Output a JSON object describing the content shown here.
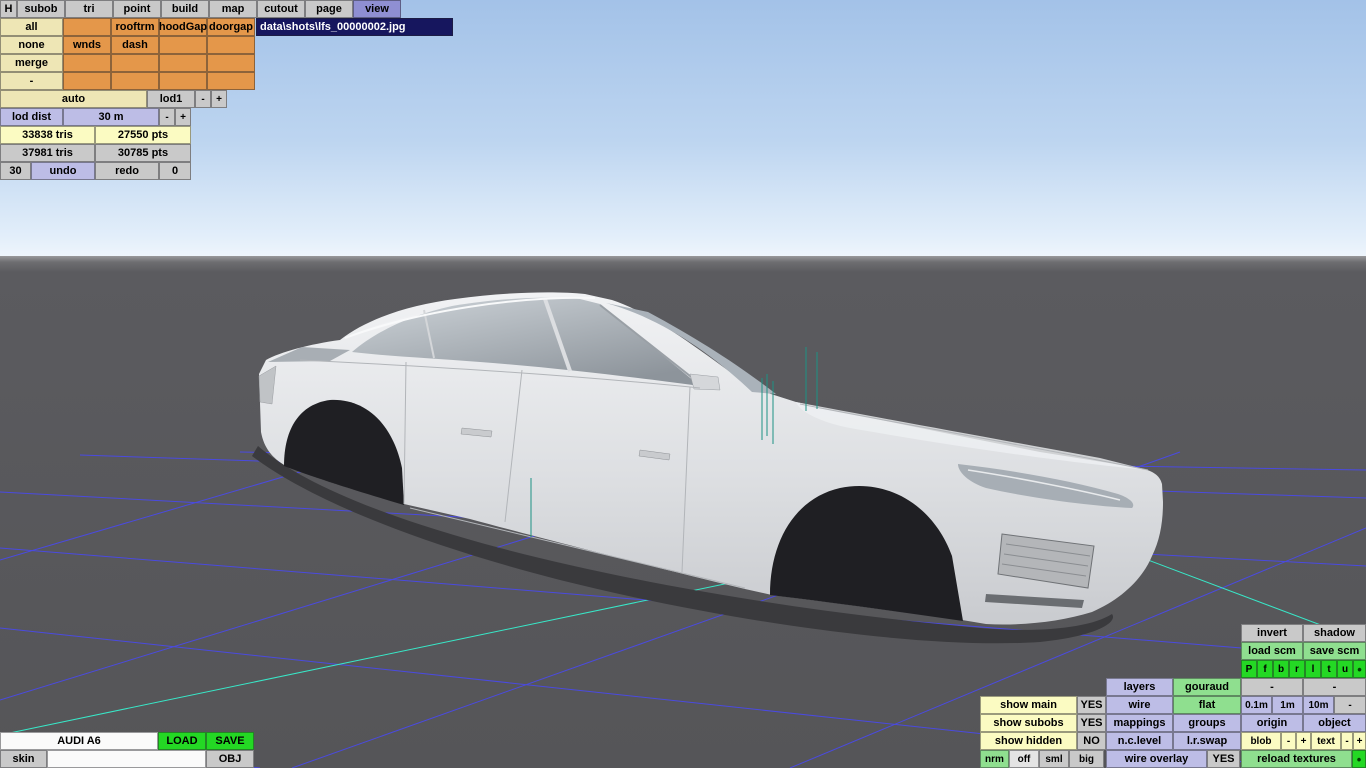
{
  "menubar": {
    "items": [
      "H",
      "subob",
      "tri",
      "point",
      "build",
      "map",
      "cutout",
      "page",
      "view"
    ],
    "active": "view"
  },
  "filebar": {
    "path": "data\\shots\\lfs_00000002.jpg"
  },
  "subob_grid": {
    "rows": [
      {
        "label": "all",
        "cells": [
          "",
          "rooftrm",
          "hoodGap",
          "doorgap"
        ]
      },
      {
        "label": "none",
        "cells": [
          "wnds",
          "dash",
          "",
          ""
        ]
      },
      {
        "label": "merge",
        "cells": [
          "",
          "",
          "",
          ""
        ]
      },
      {
        "label": "-",
        "cells": [
          "",
          "",
          "",
          ""
        ]
      }
    ]
  },
  "lod": {
    "auto": "auto",
    "current": "lod1",
    "minus": "-",
    "plus": "+",
    "dist_label": "lod dist",
    "dist_value": "30 m",
    "tris_current": "33838 tris",
    "pts_current": "27550 pts",
    "tris_total": "37981 tris",
    "pts_total": "30785 pts",
    "undo_steps": "30",
    "undo_label": "undo",
    "redo_label": "redo",
    "redo_steps": "0"
  },
  "file_panel": {
    "car_name": "AUDI A6",
    "load_label": "LOAD",
    "save_label": "SAVE",
    "skin_label": "skin",
    "skin_value": "",
    "obj_label": "OBJ"
  },
  "view_panel": {
    "invert": "invert",
    "shadow": "shadow",
    "load_scm": "load scm",
    "save_scm": "save scm",
    "view_buttons": [
      "P",
      "f",
      "b",
      "r",
      "l",
      "t",
      "u"
    ],
    "dot": "•",
    "dash": "-",
    "minus": "-",
    "plus": "+",
    "layers": "layers",
    "gouraud": "gouraud",
    "show_main": "show main",
    "show_main_value": "YES",
    "show_subobs": "show subobs",
    "show_subobs_value": "YES",
    "show_hidden": "show hidden",
    "show_hidden_value": "NO",
    "wire": "wire",
    "flat": "flat",
    "grid_scales": [
      "0.1m",
      "1m",
      "10m"
    ],
    "mappings": "mappings",
    "groups": "groups",
    "origin": "origin",
    "object": "object",
    "nc_level": "n.c.level",
    "lr_swap": "l.r.swap",
    "blob": "blob",
    "text": "text",
    "nrm": "nrm",
    "off": "off",
    "sml": "sml",
    "big": "big",
    "wire_overlay": "wire overlay",
    "wire_overlay_value": "YES",
    "reload_textures": "reload textures"
  },
  "colors": {
    "panel_orange": "#e4974a",
    "panel_tan": "#eee6b5",
    "panel_lavender": "#bdbde6",
    "panel_yellow": "#fbfbc2",
    "green_soft": "#8fdf8f",
    "green_bright": "#24d824",
    "active_purple": "#8f8fd2",
    "filebar_navy": "#16165e",
    "grid_blue": "#4a4ae8",
    "grid_cyan": "#38e8c8",
    "teal_marker": "#1d9284"
  }
}
